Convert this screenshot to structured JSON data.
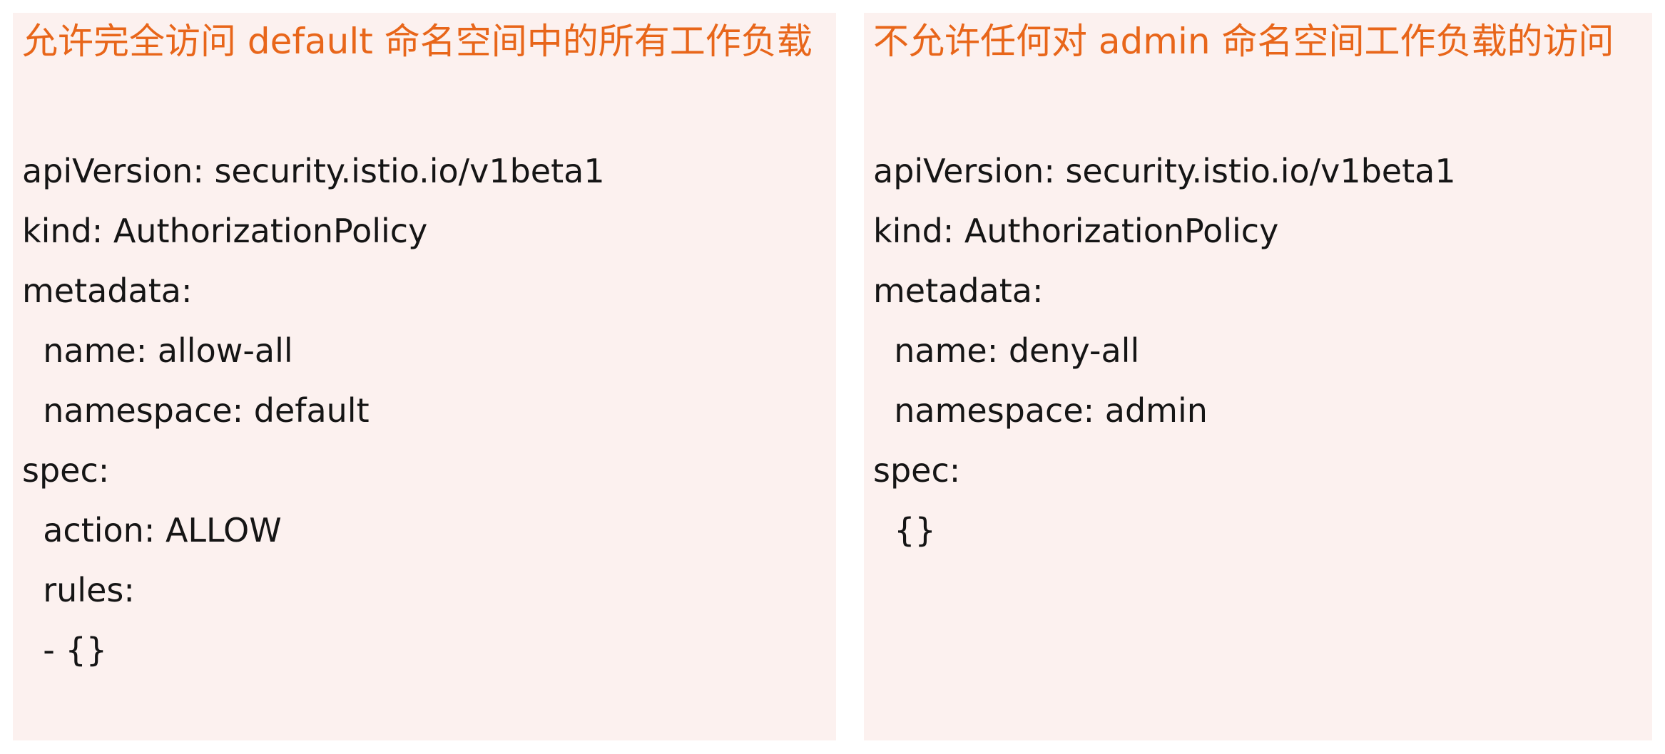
{
  "panels": [
    {
      "title": "允许完全访问 default 命名空间中的所有工作负载",
      "lines": [
        "apiVersion: security.istio.io/v1beta1",
        "kind: AuthorizationPolicy",
        "metadata:",
        "  name: allow-all",
        "  namespace: default",
        "spec:",
        "  action: ALLOW",
        "  rules:",
        "  - {}"
      ]
    },
    {
      "title": "不允许任何对 admin 命名空间工作负载的访问",
      "lines": [
        "apiVersion: security.istio.io/v1beta1",
        "kind: AuthorizationPolicy",
        "metadata:",
        "  name: deny-all",
        "  namespace: admin",
        "spec:",
        "  {}"
      ]
    }
  ],
  "colors": {
    "panel_background": "#fcf1ef",
    "title": "#e8661a",
    "code_text": "#151515"
  }
}
